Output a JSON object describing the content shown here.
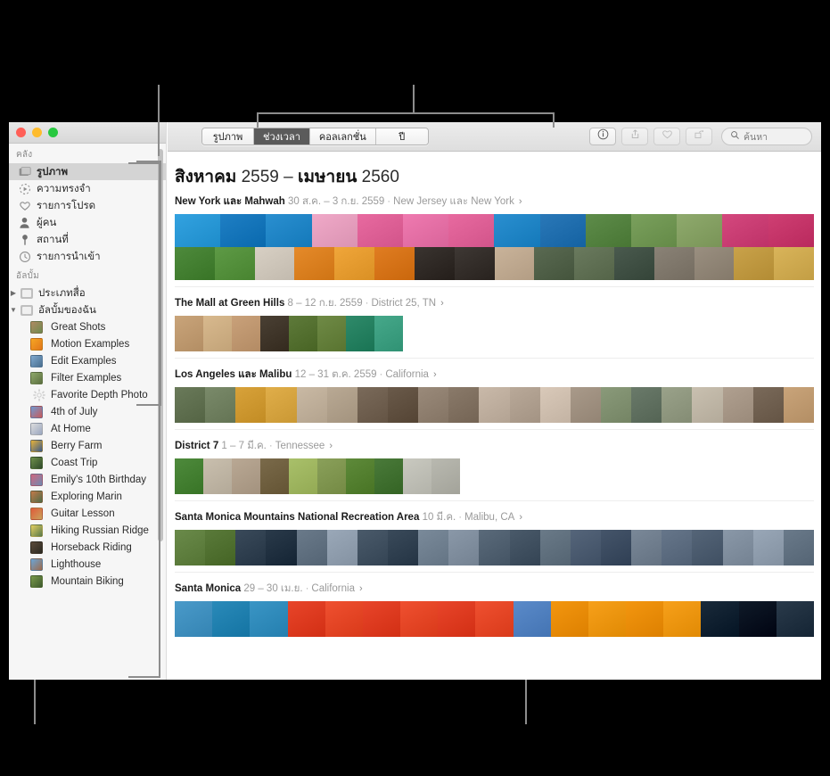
{
  "window": {
    "traffic_lights": [
      "close",
      "minimize",
      "zoom"
    ],
    "accent_selected": "#5b5b5b"
  },
  "sidebar": {
    "sections": [
      {
        "title": "คลัง",
        "items": [
          {
            "label": "รูปภาพ",
            "icon": "photos-icon",
            "selected": true
          },
          {
            "label": "ความทรงจำ",
            "icon": "memories-icon",
            "selected": false
          },
          {
            "label": "รายการโปรด",
            "icon": "heart-icon",
            "selected": false
          },
          {
            "label": "ผู้คน",
            "icon": "person-icon",
            "selected": false
          },
          {
            "label": "สถานที่",
            "icon": "pin-icon",
            "selected": false
          },
          {
            "label": "รายการนำเข้า",
            "icon": "clock-icon",
            "selected": false
          }
        ]
      },
      {
        "title": "อัลบั้ม",
        "items": [
          {
            "label": "ประเภทสื่อ",
            "icon": "folder-icon",
            "disclosure": "collapsed",
            "selected": false
          },
          {
            "label": "อัลบั้มของฉัน",
            "icon": "folder-icon",
            "disclosure": "expanded",
            "selected": false
          },
          {
            "label": "Great Shots",
            "icon": "album-thumb",
            "child": true,
            "color1": "#b08a62",
            "color2": "#6d8a4e"
          },
          {
            "label": "Motion Examples",
            "icon": "album-thumb",
            "child": true,
            "color1": "#f5a623",
            "color2": "#e2761b"
          },
          {
            "label": "Edit Examples",
            "icon": "album-thumb",
            "child": true,
            "color1": "#7fa9cf",
            "color2": "#4a6f8f"
          },
          {
            "label": "Filter Examples",
            "icon": "album-thumb",
            "child": true,
            "color1": "#8fa86a",
            "color2": "#5c7040"
          },
          {
            "label": "Favorite Depth Photo",
            "icon": "gear-icon",
            "child": true,
            "color1": "#d8d8d8",
            "color2": "#bdbdbd"
          },
          {
            "label": "4th of July",
            "icon": "album-thumb",
            "child": true,
            "color1": "#6f9ad2",
            "color2": "#c95a5a"
          },
          {
            "label": "At Home",
            "icon": "album-thumb",
            "child": true,
            "color1": "#dcdcdc",
            "color2": "#9aa7c0"
          },
          {
            "label": "Berry Farm",
            "icon": "album-thumb",
            "child": true,
            "color1": "#e8b339",
            "color2": "#3a5a8a"
          },
          {
            "label": "Coast Trip",
            "icon": "album-thumb",
            "child": true,
            "color1": "#6e8f4a",
            "color2": "#2f4a2a"
          },
          {
            "label": "Emily's 10th Birthday",
            "icon": "album-thumb",
            "child": true,
            "color1": "#d0667f",
            "color2": "#6f8ab0"
          },
          {
            "label": "Exploring Marin",
            "icon": "album-thumb",
            "child": true,
            "color1": "#c47a4a",
            "color2": "#4f6b46"
          },
          {
            "label": "Guitar Lesson",
            "icon": "album-thumb",
            "child": true,
            "color1": "#e05a3a",
            "color2": "#c9a25a"
          },
          {
            "label": "Hiking Russian Ridge",
            "icon": "album-thumb",
            "child": true,
            "color1": "#e3cf62",
            "color2": "#5a7a4a"
          },
          {
            "label": "Horseback Riding",
            "icon": "album-thumb",
            "child": true,
            "color1": "#5b4a3a",
            "color2": "#2c2a22"
          },
          {
            "label": "Lighthouse",
            "icon": "album-thumb",
            "child": true,
            "color1": "#6aa6d8",
            "color2": "#9e6a4a"
          },
          {
            "label": "Mountain Biking",
            "icon": "album-thumb",
            "child": true,
            "color1": "#7a9a4a",
            "color2": "#3e5a2e"
          }
        ]
      }
    ]
  },
  "toolbar": {
    "segments": [
      {
        "label": "รูปภาพ",
        "active": false
      },
      {
        "label": "ช่วงเวลา",
        "active": true
      },
      {
        "label": "คอลเลกชั่น",
        "active": false
      },
      {
        "label": "ปี",
        "active": false
      }
    ],
    "buttons": [
      {
        "name": "info-icon",
        "enabled": true
      },
      {
        "name": "share-icon",
        "enabled": false
      },
      {
        "name": "heart-icon",
        "enabled": false
      },
      {
        "name": "rotate-icon",
        "enabled": false
      }
    ],
    "search": {
      "placeholder": "ค้นหา",
      "icon": "search-icon",
      "value": ""
    }
  },
  "main": {
    "title_parts": [
      {
        "text": "สิงหาคม",
        "bold": true
      },
      {
        "text": " 2559 ",
        "bold": false
      },
      {
        "text": "– ",
        "bold": false
      },
      {
        "text": "เมษายน",
        "bold": true
      },
      {
        "text": " 2560",
        "bold": false
      }
    ],
    "title_plain": "สิงหาคม 2559 – เมษายน 2560",
    "moments": [
      {
        "place": "New York และ Mahwah",
        "date": "30 ส.ค. – 3 ก.ย. 2559",
        "sub": "New Jersey และ New York",
        "arrow": "›",
        "rows": 2,
        "photos_row1": [
          "#33a2e0",
          "#1f7fc4",
          "#2a8fd0",
          "#f0a9c8",
          "#e86aa0",
          "#ef7ab0",
          "#e86aa0",
          "#2a8fd0",
          "#2a78b8",
          "#5e8c4a",
          "#7aa05d",
          "#8faa6d",
          "#d4487e",
          "#cf3f73"
        ],
        "photos_row2": [
          "#4e8a3c",
          "#5e9a46",
          "#d8d0c4",
          "#e58a2a",
          "#f0a63a",
          "#e07d22",
          "#3a3430",
          "#3e3834",
          "#c9b39a",
          "#5a6a52",
          "#6a7a5e",
          "#4a5a4e",
          "#8a8276",
          "#9a8f80",
          "#c9a24a",
          "#d9b45a"
        ]
      },
      {
        "place": "The Mall at Green Hills",
        "date": "8 – 12 ก.ย. 2559",
        "sub": "District 25, TN",
        "arrow": "›",
        "rows": 1,
        "photos_row1": [
          "#c9a47a",
          "#d8b98e",
          "#c9a17a",
          "#4a4034",
          "#5e7a3a",
          "#6f8a46",
          "#2f8a6a",
          "#46a88a"
        ]
      },
      {
        "place": "Los Angeles และ Malibu",
        "date": "12 – 31 ต.ค. 2559",
        "sub": "California",
        "arrow": "›",
        "rows": 1,
        "photos_row1": [
          "#6a7a5a",
          "#7a8a6a",
          "#d8a23a",
          "#e0ae4a",
          "#c9b9a4",
          "#b9a994",
          "#7a6a5a",
          "#6a5a4a",
          "#9a8a7a",
          "#8a7a6a",
          "#c9b9a9",
          "#b9a999",
          "#d9c9b9",
          "#a99a8a",
          "#8a9a7a",
          "#6a7a6a",
          "#9aa28a",
          "#c9c0b0",
          "#b0a090",
          "#7a6a5a",
          "#c9a47a"
        ]
      },
      {
        "place": "District 7",
        "date": "1 – 7 มี.ค.",
        "sub": "Tennessee",
        "arrow": "›",
        "rows": 1,
        "photos_row1": [
          "#4e8a3c",
          "#c9bfae",
          "#b9a894",
          "#7a6a4a",
          "#a9c06a",
          "#8aa05a",
          "#5e8a3a",
          "#4a7a3a",
          "#c9c9c0",
          "#b9b9b0"
        ]
      },
      {
        "place": "Santa Monica Mountains National Recreation Area",
        "date": "10 มี.ค.",
        "sub": "Malibu, CA",
        "arrow": "›",
        "rows": 1,
        "photos_row1": [
          "#6a8a4a",
          "#5a7a3a",
          "#3a4a5a",
          "#2a3a4a",
          "#6a7a8a",
          "#9aa8b8",
          "#4a5a6a",
          "#3a4a5a",
          "#7a8a9a",
          "#8a98a8",
          "#5a6a7a",
          "#4a5a6a",
          "#6a7a88",
          "#55657a",
          "#45556a",
          "#7a8898",
          "#66768a",
          "#556578",
          "#8a98a8",
          "#99a7b7",
          "#6a7a8a"
        ]
      },
      {
        "place": "Santa Monica",
        "date": "29 – 30 เม.ย.",
        "sub": "California",
        "arrow": "›",
        "rows": 1,
        "photos_row1": [
          "#4a9ac9",
          "#2a8ab9",
          "#3a95c5",
          "#e8452a",
          "#ef5030",
          "#e8452a",
          "#ef5030",
          "#e8452a",
          "#ef5030",
          "#5a8ac9",
          "#f3960f",
          "#f7a01a",
          "#f3960f",
          "#f7a01a",
          "#1a2a3a",
          "#0f1a28",
          "#2a3a4a"
        ]
      }
    ]
  }
}
